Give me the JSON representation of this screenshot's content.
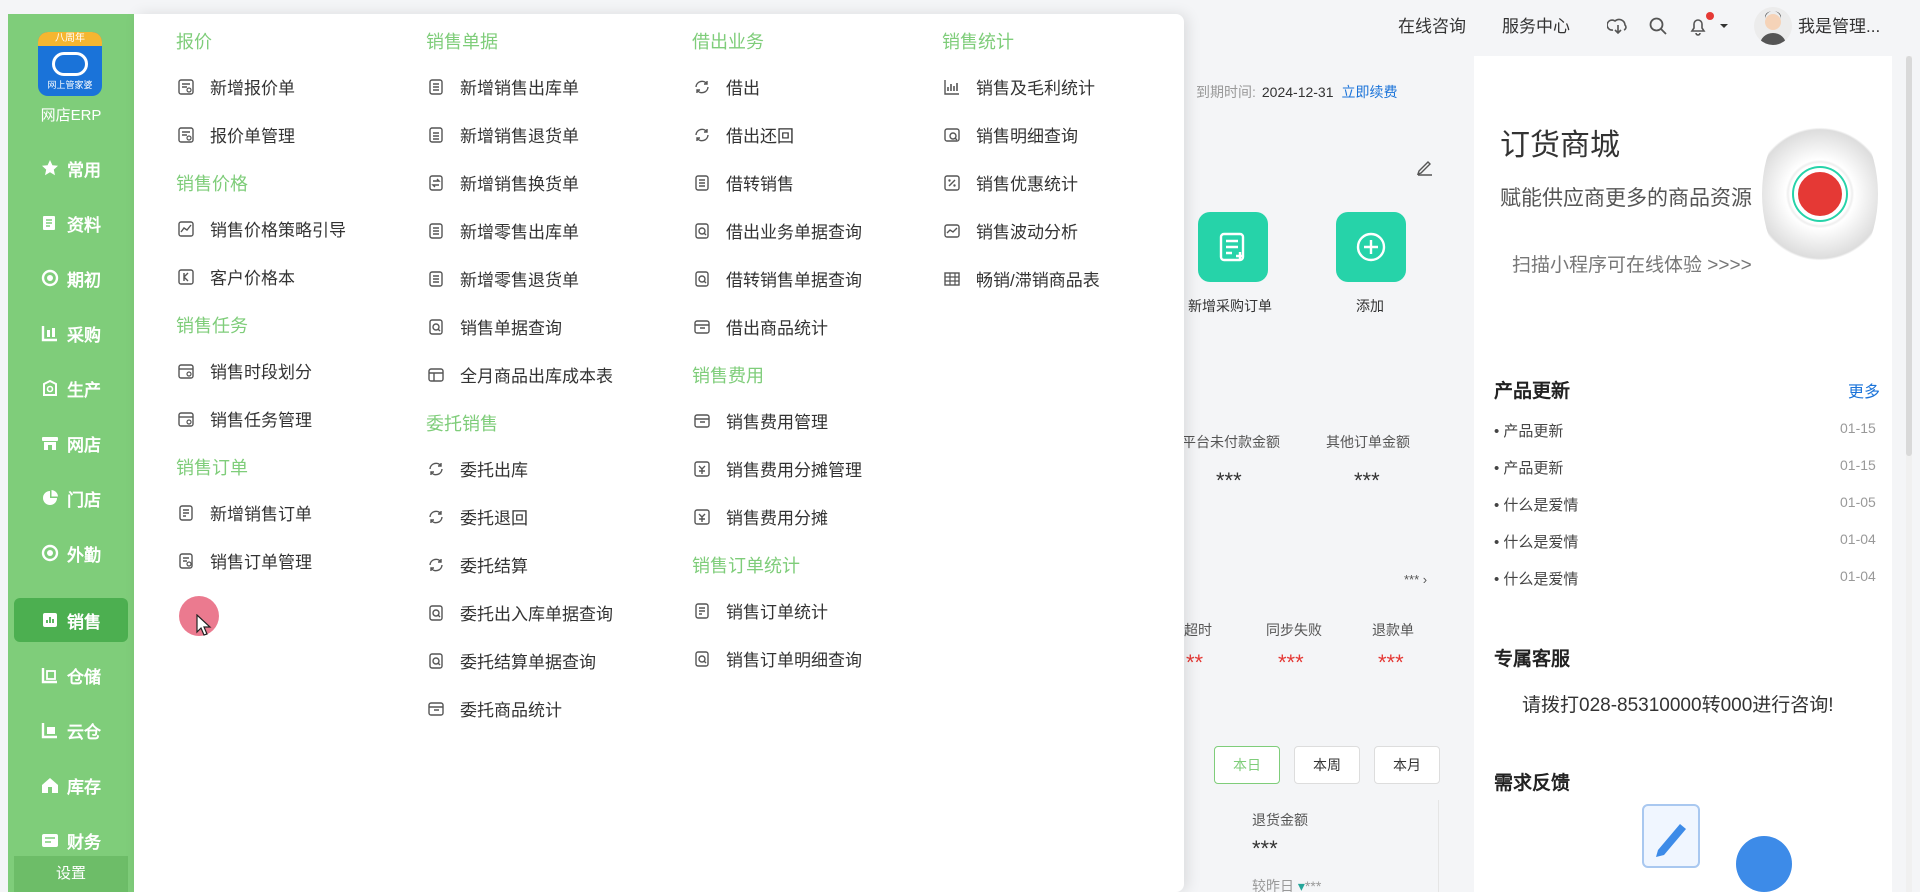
{
  "sidebar": {
    "logo_band": "八周年",
    "logo_sub": "网上管家婆",
    "logo_text": "网店ERP",
    "items": [
      {
        "label": "常用",
        "icon": "star-icon"
      },
      {
        "label": "资料",
        "icon": "document-icon"
      },
      {
        "label": "期初",
        "icon": "target-icon"
      },
      {
        "label": "采购",
        "icon": "cart-icon"
      },
      {
        "label": "生产",
        "icon": "factory-icon"
      },
      {
        "label": "网店",
        "icon": "shop-icon"
      },
      {
        "label": "门店",
        "icon": "pie-icon"
      },
      {
        "label": "外勤",
        "icon": "location-icon"
      },
      {
        "label": "销售",
        "icon": "chart-icon"
      },
      {
        "label": "仓储",
        "icon": "warehouse-icon"
      },
      {
        "label": "云仓",
        "icon": "cloud-warehouse-icon"
      },
      {
        "label": "库存",
        "icon": "home-icon"
      },
      {
        "label": "财务",
        "icon": "wallet-icon"
      }
    ],
    "settings": "设置",
    "active_index": 8
  },
  "menu": {
    "columns": [
      {
        "sections": [
          {
            "title": "报价",
            "items": [
              "新增报价单",
              "报价单管理"
            ]
          },
          {
            "title": "销售价格",
            "items": [
              "销售价格策略引导",
              "客户价格本"
            ]
          },
          {
            "title": "销售任务",
            "items": [
              "销售时段划分",
              "销售任务管理"
            ]
          },
          {
            "title": "销售订单",
            "items": [
              "新增销售订单",
              "销售订单管理"
            ]
          }
        ]
      },
      {
        "sections": [
          {
            "title": "销售单据",
            "items": [
              "新增销售出库单",
              "新增销售退货单",
              "新增销售换货单",
              "新增零售出库单",
              "新增零售退货单",
              "销售单据查询",
              "全月商品出库成本表"
            ]
          },
          {
            "title": "委托销售",
            "items": [
              "委托出库",
              "委托退回",
              "委托结算",
              "委托出入库单据查询",
              "委托结算单据查询",
              "委托商品统计"
            ]
          }
        ]
      },
      {
        "sections": [
          {
            "title": "借出业务",
            "items": [
              "借出",
              "借出还回",
              "借转销售",
              "借出业务单据查询",
              "借转销售单据查询",
              "借出商品统计"
            ]
          },
          {
            "title": "销售费用",
            "items": [
              "销售费用管理",
              "销售费用分摊管理",
              "销售费用分摊"
            ]
          },
          {
            "title": "销售订单统计",
            "items": [
              "销售订单统计",
              "销售订单明细查询"
            ]
          }
        ]
      },
      {
        "sections": [
          {
            "title": "销售统计",
            "items": [
              "销售及毛利统计",
              "销售明细查询",
              "销售优惠统计",
              "销售波动分析",
              "畅销/滞销商品表"
            ]
          }
        ]
      }
    ]
  },
  "topbar": {
    "consult": "在线咨询",
    "service": "服务中心",
    "user": "我是管理..."
  },
  "account": {
    "expire_label": "到期时间:",
    "expire_date": "2024-12-31",
    "renew": "立即续费"
  },
  "quick_actions": [
    {
      "label": "新增采购订单",
      "icon": "purchase-order-icon"
    },
    {
      "label": "添加",
      "icon": "plus-icon"
    }
  ],
  "stats1": [
    {
      "label": "平台未付款金额",
      "value": "***"
    },
    {
      "label": "其他订单金额",
      "value": "***"
    }
  ],
  "more_masked": "***",
  "stats2": [
    {
      "label": "超时",
      "value": "**"
    },
    {
      "label": "同步失败",
      "value": "***"
    },
    {
      "label": "退款单",
      "value": "***"
    }
  ],
  "periods": [
    "本日",
    "本周",
    "本月"
  ],
  "active_period": 0,
  "returns": {
    "label": "退货金额",
    "value": "***",
    "compare": "较昨日",
    "compare_value": "***"
  },
  "banner": {
    "title": "订货商城",
    "subtitle": "赋能供应商更多的商品资源",
    "scan": "扫描小程序可在线体验 >>>>"
  },
  "updates": {
    "title": "产品更新",
    "more": "更多",
    "items": [
      {
        "text": "产品更新",
        "date": "01-15"
      },
      {
        "text": "产品更新",
        "date": "01-15"
      },
      {
        "text": "什么是爱情",
        "date": "01-05"
      },
      {
        "text": "什么是爱情",
        "date": "01-04"
      },
      {
        "text": "什么是爱情",
        "date": "01-04"
      }
    ]
  },
  "support": {
    "title": "专属客服",
    "text": "请拨打028-85310000转000进行咨询!"
  },
  "feedback": {
    "title": "需求反馈"
  },
  "colors": {
    "sidebar": "#7fcd7a",
    "active": "#4caf50",
    "accent": "#26d3a9",
    "link": "#1a73d9",
    "alert": "#e53935"
  }
}
